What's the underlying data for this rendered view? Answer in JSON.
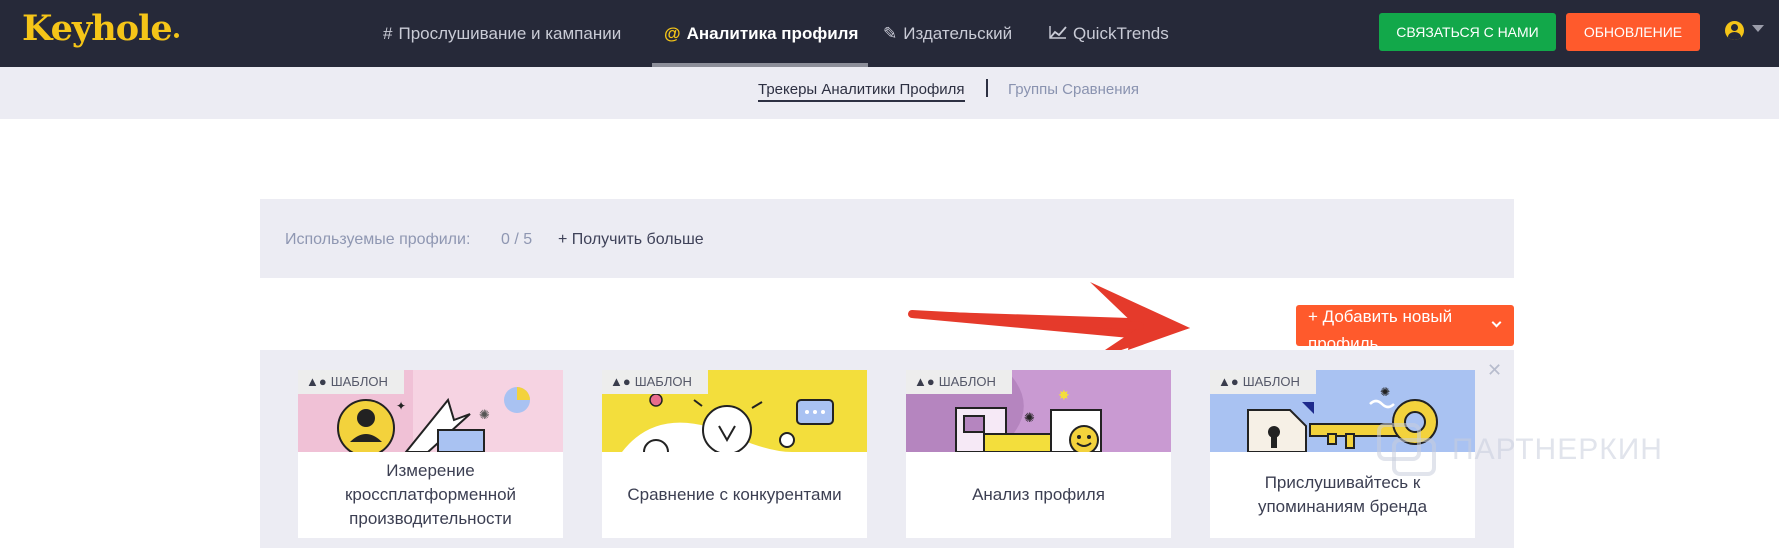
{
  "header": {
    "logo": "Keyhole",
    "nav": [
      {
        "icon": "hash-icon",
        "glyph": "#",
        "label": "Прослушивание и кампании"
      },
      {
        "icon": "at-icon",
        "glyph": "@",
        "label": "Аналитика профиля"
      },
      {
        "icon": "pen-icon",
        "glyph": "✎",
        "label": "Издательский"
      },
      {
        "icon": "trend-icon",
        "glyph": "⟋",
        "label": "QuickTrends"
      }
    ],
    "contact_label": "СВЯЗАТЬСЯ С НАМИ",
    "upgrade_label": "ОБНОВЛЕНИЕ",
    "colors": {
      "bar": "#262939",
      "contact": "#12a84a",
      "upgrade": "#ff5a2c",
      "logo": "#f5c518"
    }
  },
  "subnav": {
    "active": "Трекеры Аналитики Профиля",
    "inactive": "Группы Сравнения"
  },
  "profiles": {
    "label": "Используемые профили:",
    "count": "0 / 5",
    "more": "+ Получить больше"
  },
  "add_button": {
    "label": "+ Добавить новый профиль"
  },
  "templates": {
    "badge": "ШАБЛОН",
    "cards": [
      {
        "title": "Измерение кроссплатформенной производительности",
        "bg": "#f0c1d6"
      },
      {
        "title": "Сравнение с конкурентами",
        "bg": "#f3de3c"
      },
      {
        "title": "Анализ профиля",
        "bg": "#b585bf"
      },
      {
        "title": "Прислушивайтесь к упоминаниям бренда",
        "bg": "#a9c2f2"
      }
    ]
  },
  "watermark": "ПАРТНЕРКИН"
}
